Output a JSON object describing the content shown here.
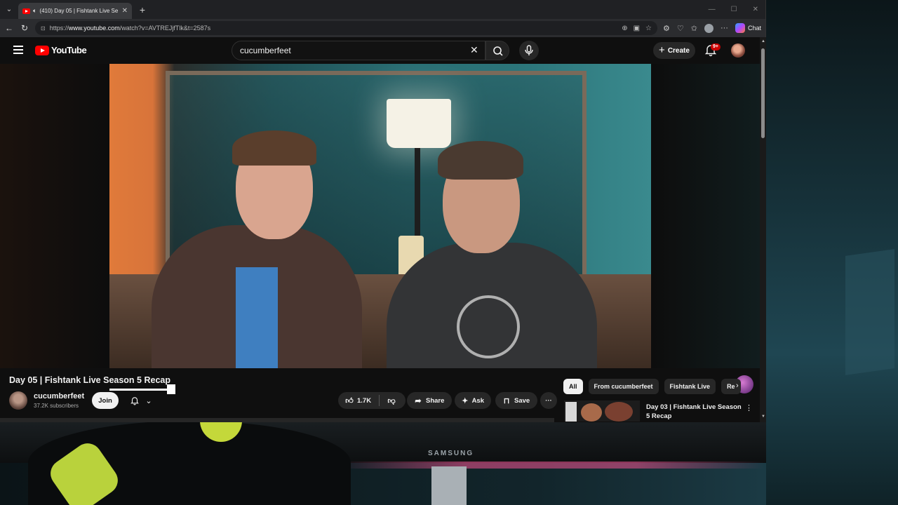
{
  "browser": {
    "tab_title": "(410) Day 05 | Fishtank Live Se",
    "tab_close": "✕",
    "new_tab": "+",
    "url_prefix": "https://",
    "url_host": "www.youtube.com",
    "url_path": "/watch?v=AVTREJjfTlk&t=2587s",
    "chat_label": "Chat"
  },
  "youtube": {
    "logo_text": "YouTube",
    "search_value": "cucumberfeet",
    "create_label": "Create",
    "notif_badge": "9+",
    "video": {
      "title": "Day 05 | Fishtank Live Season 5 Recap",
      "channel": "cucumberfeet",
      "subscribers": "37.2K subscribers",
      "join_label": "Join",
      "likes": "1.7K",
      "share_label": "Share",
      "ask_label": "Ask",
      "save_label": "Save"
    },
    "chips": [
      "All",
      "From cucumberfeet",
      "Fishtank Live",
      "Re"
    ],
    "recommendation": {
      "title": "Day 03 | Fishtank Live Season 5 Recap"
    }
  },
  "monitor": {
    "brand": "SAMSUNG"
  },
  "colors": {
    "yt_red": "#ff0000",
    "page_bg": "#0f0f0f",
    "pill_bg": "#272727"
  }
}
